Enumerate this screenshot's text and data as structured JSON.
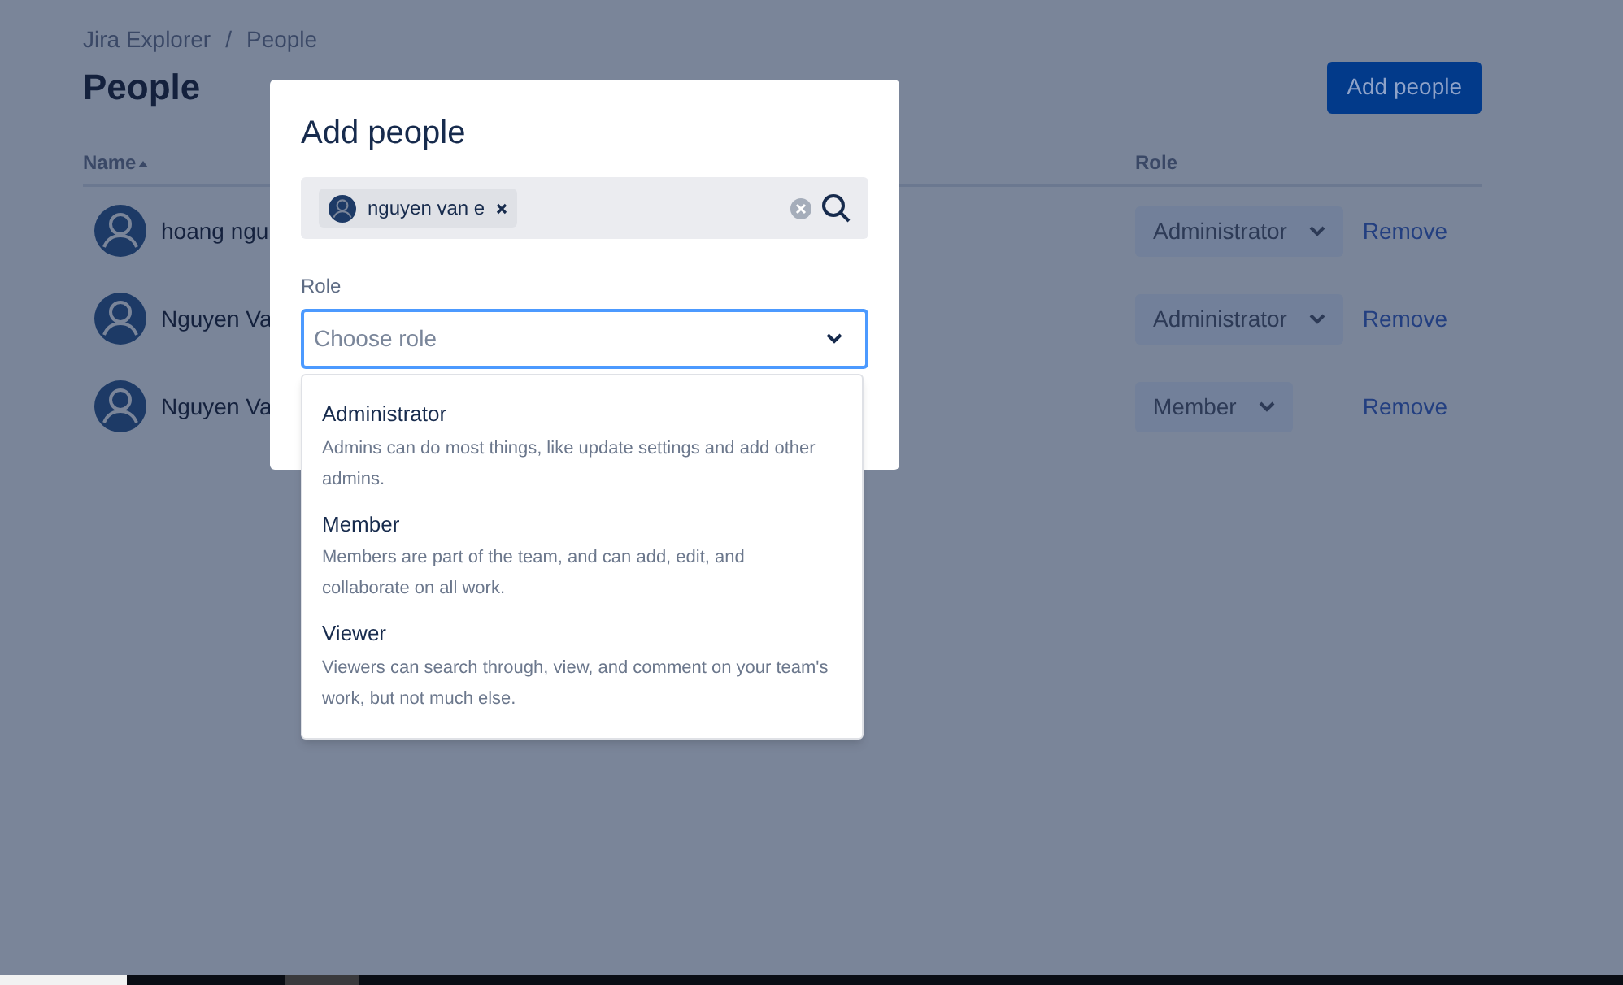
{
  "breadcrumbs": [
    "Jira Explorer",
    "People"
  ],
  "breadcrumb_separator": "/",
  "title": "People",
  "add_button": "Add people",
  "table": {
    "columns": [
      {
        "label": "Name",
        "sorted": true
      },
      {
        "label": "Role",
        "sorted": false
      }
    ],
    "rows": [
      {
        "name": "hoang ngu",
        "role": "Administrator",
        "action": "Remove"
      },
      {
        "name": "Nguyen Va",
        "role": "Administrator",
        "action": "Remove"
      },
      {
        "name": "Nguyen Va",
        "role": "Member",
        "action": "Remove"
      }
    ]
  },
  "dialog": {
    "title": "Add people",
    "chips": [
      {
        "label": "nguyen van e"
      }
    ],
    "role_label": "Role",
    "role_placeholder": "Choose role",
    "options": [
      {
        "label": "Administrator",
        "description": "Admins can do most things, like update settings and add other admins."
      },
      {
        "label": "Member",
        "description": "Members are part of the team, and can add, edit, and collaborate on all work."
      },
      {
        "label": "Viewer",
        "description": "Viewers can search through, view, and comment on your team's work, but not much else."
      }
    ]
  }
}
